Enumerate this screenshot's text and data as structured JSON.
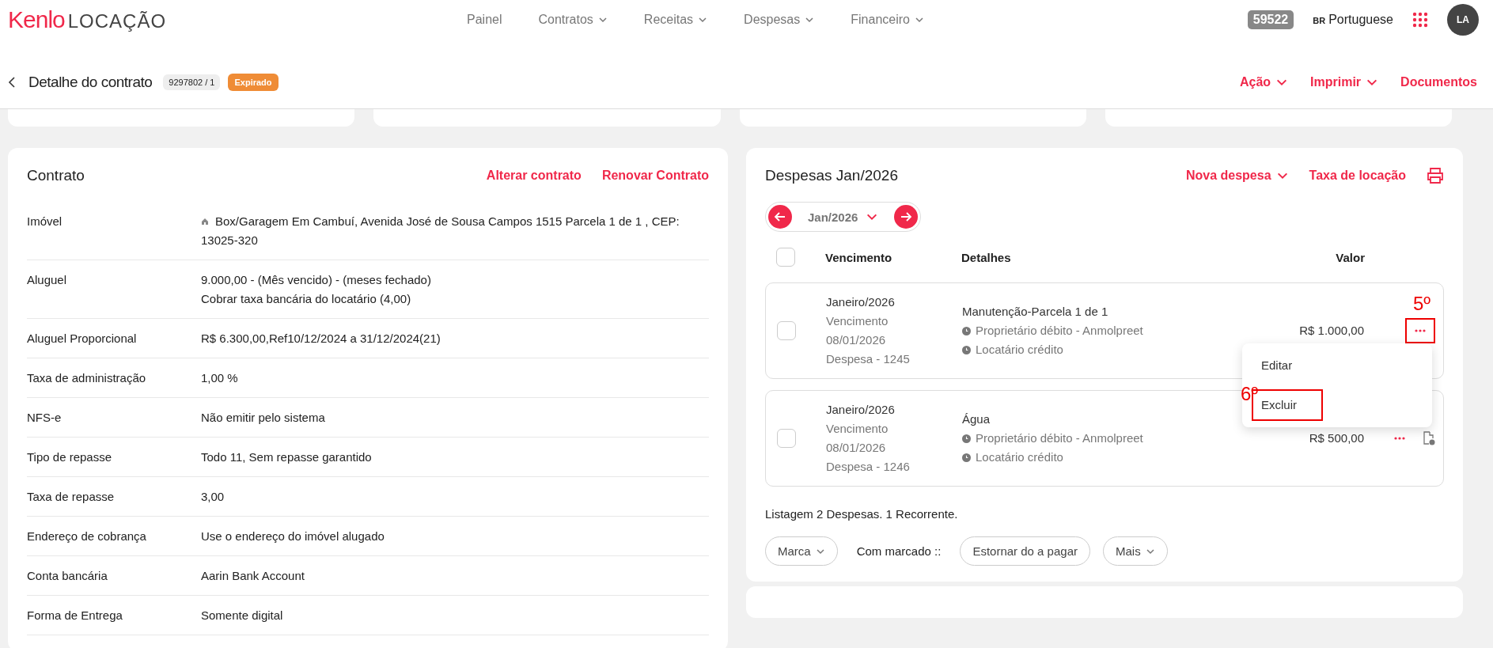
{
  "header": {
    "logo_brand": "Kenlo",
    "logo_product": "LOCAÇÃO",
    "nav": [
      {
        "label": "Painel",
        "dropdown": false
      },
      {
        "label": "Contratos",
        "dropdown": true
      },
      {
        "label": "Receitas",
        "dropdown": true
      },
      {
        "label": "Despesas",
        "dropdown": true
      },
      {
        "label": "Financeiro",
        "dropdown": true
      }
    ],
    "account_badge": "59522",
    "language_code": "BR",
    "language": "Portuguese",
    "avatar": "LA"
  },
  "page": {
    "title": "Detalhe do contrato",
    "contract_number": "9297802 / 1",
    "status": "Expirado",
    "actions": [
      {
        "label": "Ação",
        "dropdown": true
      },
      {
        "label": "Imprimir",
        "dropdown": true
      },
      {
        "label": "Documentos",
        "dropdown": false
      }
    ]
  },
  "contract": {
    "title": "Contrato",
    "actions": [
      "Alterar contrato",
      "Renovar Contrato"
    ],
    "fields": [
      {
        "label": "Imóvel",
        "lines": [
          "Box/Garagem Em Cambuí, Avenida José de Sousa Campos 1515 Parcela 1 de 1 , CEP: 13025-320"
        ],
        "kind": "address"
      },
      {
        "label": "Aluguel",
        "lines": [
          "9.000,00 - (Mês vencido) - (meses fechado)",
          "Cobrar taxa bancária do locatário (4,00)"
        ]
      },
      {
        "label": "Aluguel Proporcional",
        "lines": [
          "R$ 6.300,00,Ref10/12/2024 a 31/12/2024(21)"
        ]
      },
      {
        "label": "Taxa de administração",
        "lines": [
          "1,00 %"
        ]
      },
      {
        "label": "NFS-e",
        "lines": [
          "Não emitir pelo sistema"
        ]
      },
      {
        "label": "Tipo de repasse",
        "lines": [
          "Todo 11, Sem repasse garantido"
        ]
      },
      {
        "label": "Taxa de repasse",
        "lines": [
          "3,00"
        ]
      },
      {
        "label": "Endereço de cobrança",
        "lines": [
          "Use o endereço do imóvel alugado"
        ]
      },
      {
        "label": "Conta bancária",
        "lines": [
          "Aarin Bank Account"
        ]
      },
      {
        "label": "Forma de Entrega",
        "lines": [
          "Somente digital"
        ]
      }
    ]
  },
  "expenses": {
    "title": "Despesas Jan/2026",
    "actions": [
      {
        "label": "Nova despesa",
        "dropdown": true
      },
      {
        "label": "Taxa de locação",
        "dropdown": false
      }
    ],
    "month": "Jan/2026",
    "select_all_checked": false,
    "columns": [
      "Vencimento",
      "Detalhes",
      "Valor"
    ],
    "rows": [
      {
        "checked": false,
        "month": "Janeiro/2026",
        "due_label": "Vencimento",
        "due_date": "08/01/2026",
        "expense_id": "Despesa - 1245",
        "description": "Manutenção-Parcela 1 de 1",
        "owner": "Proprietário débito - Anmolpreet",
        "tenant": "Locatário crédito",
        "value": "R$ 1.000,00",
        "annotation": "5º",
        "recurring": false,
        "menu_open": true
      },
      {
        "checked": false,
        "month": "Janeiro/2026",
        "due_label": "Vencimento",
        "due_date": "08/01/2026",
        "expense_id": "Despesa - 1246",
        "description": "Água",
        "owner": "Proprietário débito - Anmolpreet",
        "tenant": "Locatário crédito",
        "value": "R$ 500,00",
        "recurring": true,
        "menu_open": false
      }
    ],
    "menu": [
      {
        "label": "Editar"
      },
      {
        "label": "Excluir",
        "annotation": "6º"
      }
    ],
    "summary": "Listagem 2 Despesas. 1 Recorrente.",
    "footer": {
      "mark": "Marca",
      "with_marked": "Com marcado ::",
      "buttons": [
        {
          "label": "Estornar do a pagar",
          "dropdown": false
        },
        {
          "label": "Mais",
          "dropdown": true
        }
      ]
    }
  }
}
